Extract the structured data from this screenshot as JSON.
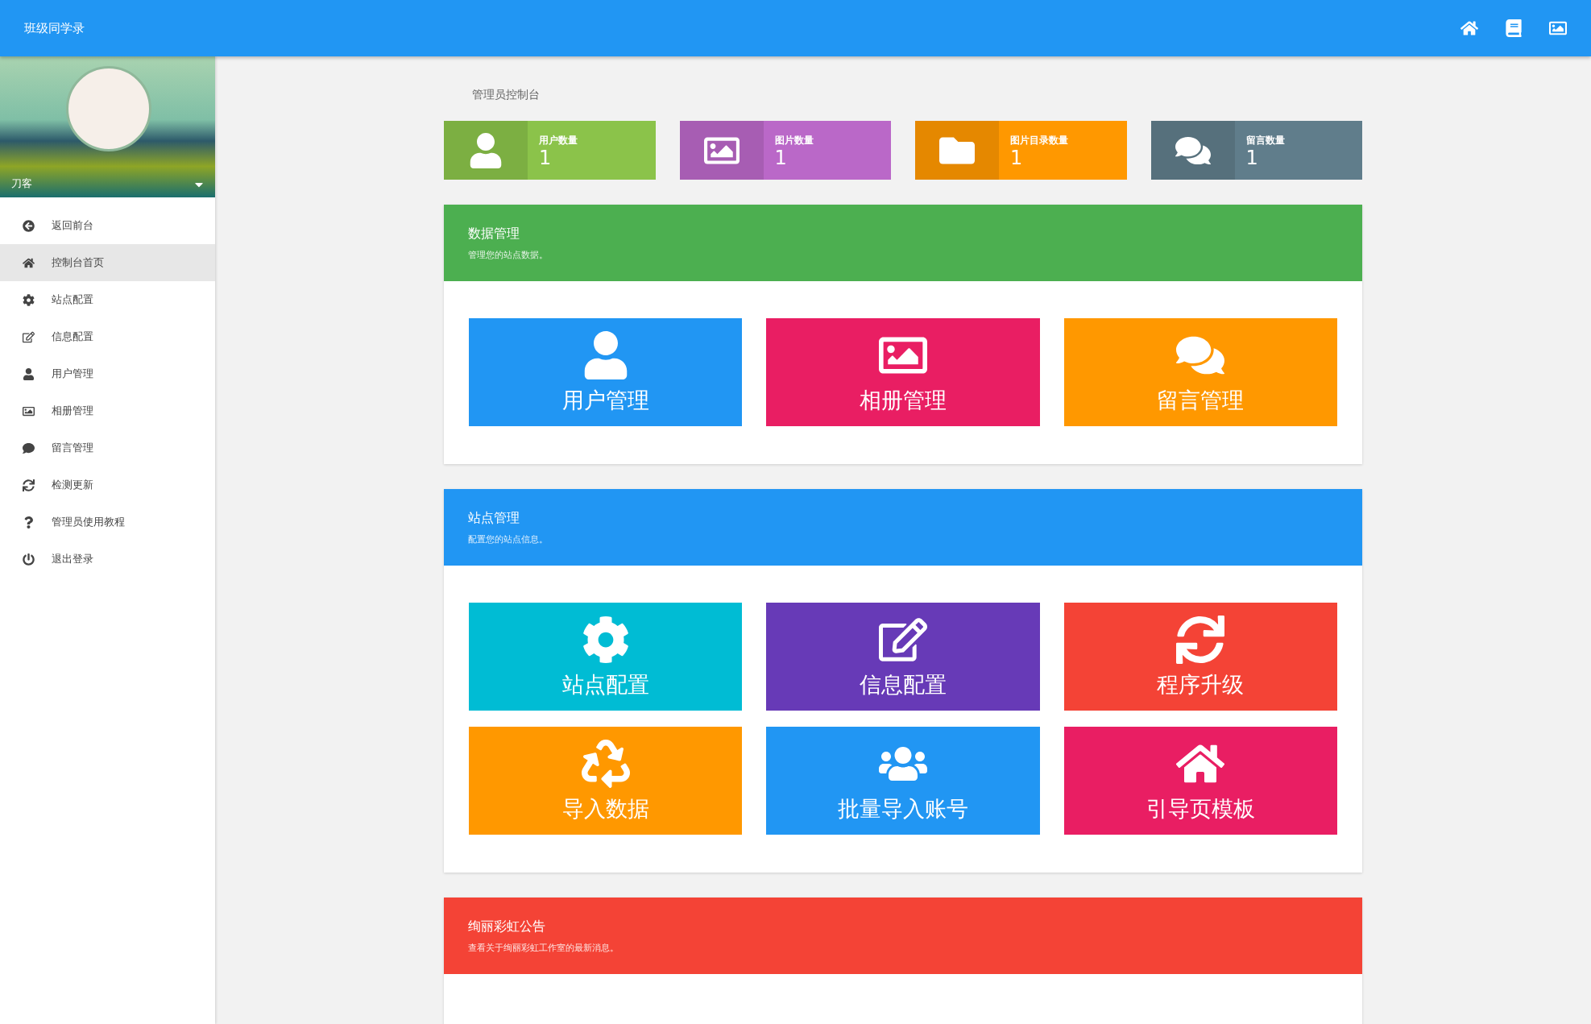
{
  "header": {
    "title": "班级同学录"
  },
  "profile": {
    "name": "刀客"
  },
  "sidebar": {
    "items": [
      {
        "label": "返回前台",
        "selected": false
      },
      {
        "label": "控制台首页",
        "selected": true
      },
      {
        "label": "站点配置",
        "selected": false
      },
      {
        "label": "信息配置",
        "selected": false
      },
      {
        "label": "用户管理",
        "selected": false
      },
      {
        "label": "相册管理",
        "selected": false
      },
      {
        "label": "留言管理",
        "selected": false
      },
      {
        "label": "检测更新",
        "selected": false
      },
      {
        "label": "管理员使用教程",
        "selected": false
      },
      {
        "label": "退出登录",
        "selected": false
      }
    ]
  },
  "breadcrumb": "管理员控制台",
  "stats": [
    {
      "label": "用户数量",
      "value": "1",
      "color": "#8bc34a"
    },
    {
      "label": "图片数量",
      "value": "1",
      "color": "#ba68c8"
    },
    {
      "label": "图片目录数量",
      "value": "1",
      "color": "#ff9800"
    },
    {
      "label": "留言数量",
      "value": "1",
      "color": "#607d8b"
    }
  ],
  "panels": [
    {
      "title": "数据管理",
      "subtitle": "管理您的站点数据。",
      "color": "#4caf50",
      "tiles": [
        {
          "label": "用户管理",
          "color": "#2196f3"
        },
        {
          "label": "相册管理",
          "color": "#e91e63"
        },
        {
          "label": "留言管理",
          "color": "#ff9800"
        }
      ]
    },
    {
      "title": "站点管理",
      "subtitle": "配置您的站点信息。",
      "color": "#2196f3",
      "tiles": [
        {
          "label": "站点配置",
          "color": "#00bcd4"
        },
        {
          "label": "信息配置",
          "color": "#673ab7"
        },
        {
          "label": "程序升级",
          "color": "#f44336"
        },
        {
          "label": "导入数据",
          "color": "#ff9800"
        },
        {
          "label": "批量导入账号",
          "color": "#2196f3"
        },
        {
          "label": "引导页模板",
          "color": "#e91e63"
        }
      ]
    },
    {
      "title": "绚丽彩虹公告",
      "subtitle": "查看关于绚丽彩虹工作室的最新消息。",
      "color": "#f44336"
    }
  ]
}
